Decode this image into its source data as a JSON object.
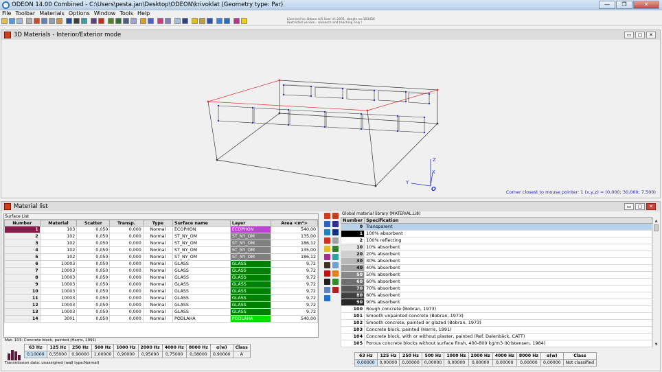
{
  "app": {
    "title": "ODEON 14.00 Combined  -  C:\\Users\\pesta.jan\\Desktop\\ODEON\\krivoklat     (Geometry type: Par)"
  },
  "menu": [
    "File",
    "Toolbar",
    "Materials",
    "Options",
    "Window",
    "Tools",
    "Help"
  ],
  "license": [
    "Licensed to: Odeon A/S   User id: 2001, dongle no:103456",
    "Restricted version - research and teaching only !"
  ],
  "window3d": {
    "title": "3D Materials - Interior/Exterior mode",
    "status": "Corner closest to mouse pointer: 1  (x,y,z) = (0,000; 30,000; 7,500)",
    "axes": {
      "z": "Z",
      "y": "Y",
      "x": "X",
      "origin": "O"
    }
  },
  "materialList": {
    "title": "Material list",
    "groupLabel": "Surface List",
    "columns": [
      "Number",
      "Material",
      "Scatter",
      "Transp.",
      "Type",
      "Surface name",
      "Layer",
      "Area <m²>"
    ],
    "rows": [
      [
        "1",
        "103",
        "0,050",
        "0,000",
        "Normal",
        "ECOPHON",
        "ECOPHON",
        "540,00"
      ],
      [
        "2",
        "102",
        "0,050",
        "0,000",
        "Normal",
        "ST_NY_OM",
        "ST_NY_OM",
        "135,00"
      ],
      [
        "3",
        "102",
        "0,050",
        "0,000",
        "Normal",
        "ST_NY_OM",
        "ST_NY_OM",
        "186,12"
      ],
      [
        "4",
        "102",
        "0,050",
        "0,000",
        "Normal",
        "ST_NY_OM",
        "ST_NY_OM",
        "135,00"
      ],
      [
        "5",
        "102",
        "0,050",
        "0,000",
        "Normal",
        "ST_NY_OM",
        "ST_NY_OM",
        "186,12"
      ],
      [
        "6",
        "10003",
        "0,050",
        "0,000",
        "Normal",
        "GLASS",
        "GLASS",
        "9,72"
      ],
      [
        "7",
        "10003",
        "0,050",
        "0,000",
        "Normal",
        "GLASS",
        "GLASS",
        "9,72"
      ],
      [
        "8",
        "10003",
        "0,050",
        "0,000",
        "Normal",
        "GLASS",
        "GLASS",
        "9,72"
      ],
      [
        "9",
        "10003",
        "0,050",
        "0,000",
        "Normal",
        "GLASS",
        "GLASS",
        "9,72"
      ],
      [
        "10",
        "10003",
        "0,050",
        "0,000",
        "Normal",
        "GLASS",
        "GLASS",
        "9,72"
      ],
      [
        "11",
        "10003",
        "0,050",
        "0,000",
        "Normal",
        "GLASS",
        "GLASS",
        "9,72"
      ],
      [
        "12",
        "10003",
        "0,050",
        "0,000",
        "Normal",
        "GLASS",
        "GLASS",
        "9,72"
      ],
      [
        "13",
        "10003",
        "0,050",
        "0,000",
        "Normal",
        "GLASS",
        "GLASS",
        "9,72"
      ],
      [
        "14",
        "3001",
        "0,050",
        "0,000",
        "Normal",
        "PODLAHA",
        "PODLAHA",
        "540,00"
      ]
    ],
    "layerColors": {
      "ECOPHON": "#c040d8",
      "ST_NY_OM": "#808080",
      "GLASS": "#008000",
      "PODLAHA": "#00e000"
    },
    "selectedMaterial": "Mat. 103: Concrete block, painted (Harris, 1991)",
    "absHeaders": [
      "63 Hz",
      "125 Hz",
      "250 Hz",
      "500 Hz",
      "1000 Hz",
      "2000 Hz",
      "4000 Hz",
      "8000 Hz",
      "α(w)",
      "Class"
    ],
    "absValues": [
      "0,10000",
      "0,55000",
      "0,90000",
      "1,00000",
      "0,90000",
      "0,95000",
      "0,75000",
      "0,08000",
      "0,90000",
      "A"
    ],
    "transmission": "Transmission data: unassigned (wall type:Normal)"
  },
  "globalLibrary": {
    "caption": "Global material library (MATERIAL.Li8)",
    "columns": [
      "Number",
      "Specification"
    ],
    "rows": [
      [
        "0",
        "Transparent"
      ],
      [
        "1",
        "100% absorbent"
      ],
      [
        "2",
        "100% reflecting"
      ],
      [
        "10",
        "10% absorbent"
      ],
      [
        "20",
        "20% absorbent"
      ],
      [
        "30",
        "30% absorbent"
      ],
      [
        "40",
        "40% absorbent"
      ],
      [
        "50",
        "50% absorbent"
      ],
      [
        "60",
        "60% absorbent"
      ],
      [
        "70",
        "70% absorbent"
      ],
      [
        "80",
        "80% absorbent"
      ],
      [
        "90",
        "90% absorbent"
      ],
      [
        "100",
        "Rough concrete (Bobran, 1973)"
      ],
      [
        "101",
        "Smooth unpainted concrete (Bobran, 1973)"
      ],
      [
        "102",
        "Smooth concrete, painted or glazed (Bobran, 1973)"
      ],
      [
        "103",
        "Concrete block, painted (Harris, 1991)"
      ],
      [
        "104",
        "Concrete block, with or without plaster, painted (Ref. Dalenbäck, CATT)"
      ],
      [
        "105",
        "Porous concrete blocks without surface finsh, 400-800 kg/m3 (Kristensen, 1984)"
      ]
    ],
    "numberShades": {
      "1": "#000000",
      "10": "#e6e6e6",
      "20": "#d0d0d0",
      "30": "#b8b8b8",
      "40": "#a0a0a0",
      "50": "#888888",
      "60": "#707070",
      "70": "#585858",
      "80": "#404040",
      "90": "#282828"
    },
    "absHeaders": [
      "63 Hz",
      "125 Hz",
      "250 Hz",
      "500 Hz",
      "1000 Hz",
      "2000 Hz",
      "4000 Hz",
      "8000 Hz",
      "α(w)",
      "Class"
    ],
    "absValues": [
      "0,00000",
      "0,00000",
      "0,00000",
      "0,00000",
      "0,00000",
      "0,00000",
      "0,00000",
      "0,00000",
      "0,00000",
      "Not classified"
    ]
  }
}
